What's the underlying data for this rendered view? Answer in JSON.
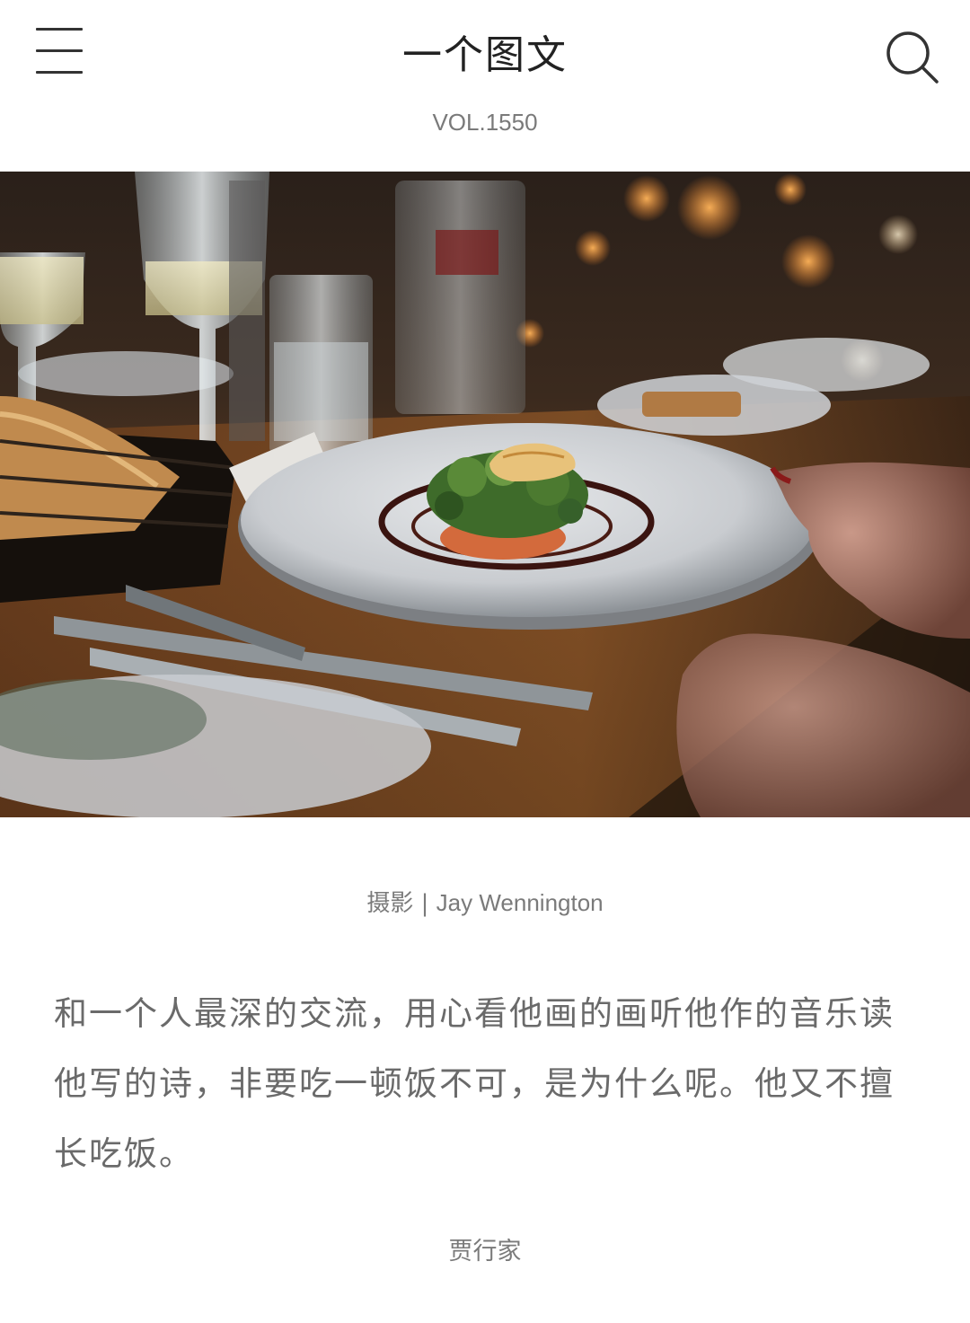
{
  "header": {
    "title": "一个图文",
    "volume": "VOL.1550"
  },
  "icons": {
    "menu": "hamburger-menu-icon",
    "search": "search-icon"
  },
  "photo": {
    "credit_label": "摄影 | ",
    "photographer": "Jay Wennington",
    "description_icon": "restaurant-dinner-table-photo"
  },
  "article": {
    "quote": "和一个人最深的交流，用心看他画的画听他作的音乐读他写的诗，非要吃一顿饭不可，是为什么呢。他又不擅长吃饭。",
    "author": "贾行家"
  },
  "colors": {
    "background": "#ffffff",
    "title": "#222222",
    "meta_text": "#7a7a7a",
    "body_text": "#6a6a6a"
  }
}
